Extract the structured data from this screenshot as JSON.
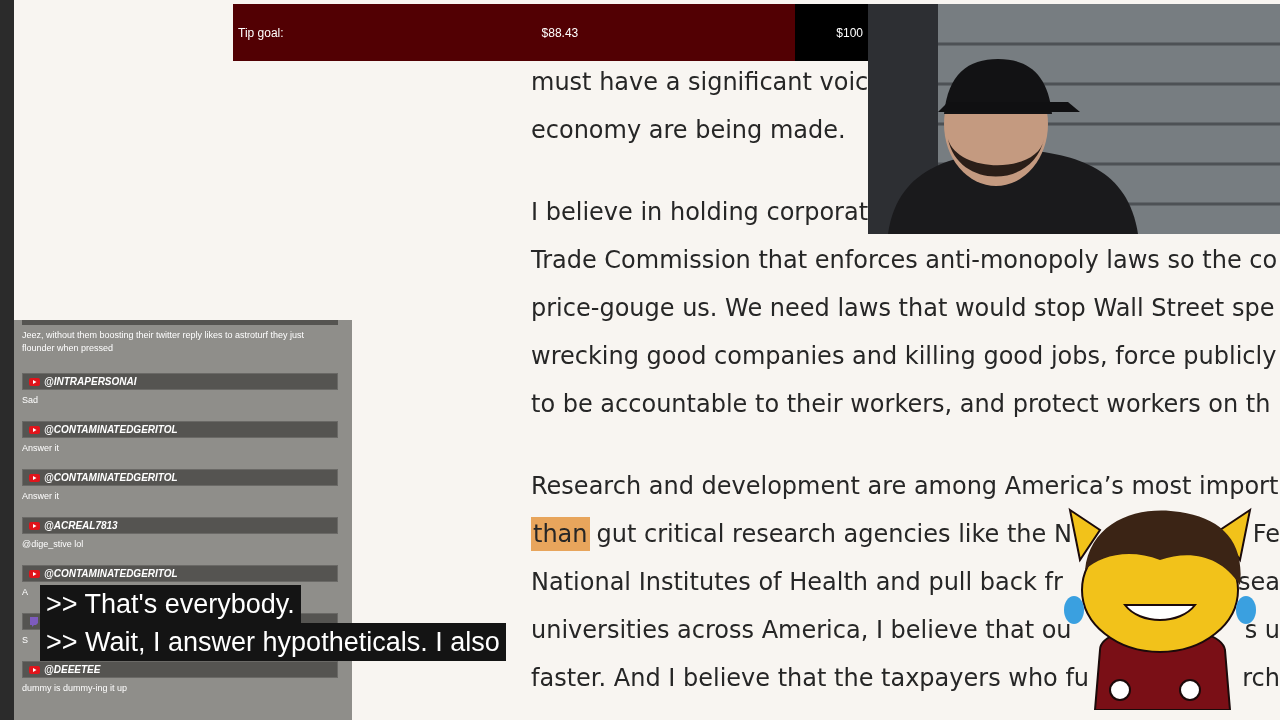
{
  "tip_goal": {
    "label": "Tip goal:",
    "amount": "$88.43",
    "target": "$100",
    "level": 0.8843
  },
  "chat": {
    "cut_message": "Jeez, without them boosting their twitter reply likes to astroturf they just flounder when pressed",
    "messages": [
      {
        "kind": "youtube",
        "author": "@INTRAPERSONAI",
        "text": "Sad"
      },
      {
        "kind": "youtube",
        "author": "@CONTAMINATEDGERITOL",
        "text": "Answer it"
      },
      {
        "kind": "youtube",
        "author": "@CONTAMINATEDGERITOL",
        "text": "Answer it"
      },
      {
        "kind": "youtube",
        "author": "@ACREAL7813",
        "text": "@dige_stive lol"
      },
      {
        "kind": "youtube",
        "author": "@CONTAMINATEDGERITOL",
        "text": "A"
      },
      {
        "kind": "twitch",
        "text": "S"
      },
      {
        "kind": "youtube",
        "author": "@DEEETEE",
        "text": "dummy is dummy-ing it up"
      }
    ]
  },
  "article": {
    "paragraphs": [
      {
        "lines": [
          {
            "text": "must have a significant voic"
          },
          {
            "text": "economy are being made."
          }
        ]
      },
      {
        "lines": [
          {
            "text": "I believe in holding corporat"
          },
          {
            "text": "Trade Commission that enforces anti-monopoly laws so the co"
          },
          {
            "text": "price-gouge us. We need laws that would stop Wall Street spe"
          },
          {
            "text": "wrecking good companies and killing good jobs, force publicly"
          },
          {
            "text": "to be accountable to their workers, and protect workers on th"
          }
        ]
      },
      {
        "lines": [
          {
            "text": "Research and development are among America’s most import"
          },
          {
            "highlight": "than",
            "text": "gut critical research agencies like the N",
            "tail": "Fe"
          },
          {
            "text": "National Institutes of Health and pull back fr",
            "tail": "sea"
          },
          {
            "text": "universities across America, I believe that ou",
            "tail": "s u"
          },
          {
            "text": "faster. And I believe that the taxpayers who fu",
            "tail": "rch"
          }
        ]
      }
    ]
  },
  "webcam": {
    "kind": "picture"
  },
  "captions": [
    ">> That's everybody.",
    ">> Wait, I answer hypotheticals. I also"
  ]
}
